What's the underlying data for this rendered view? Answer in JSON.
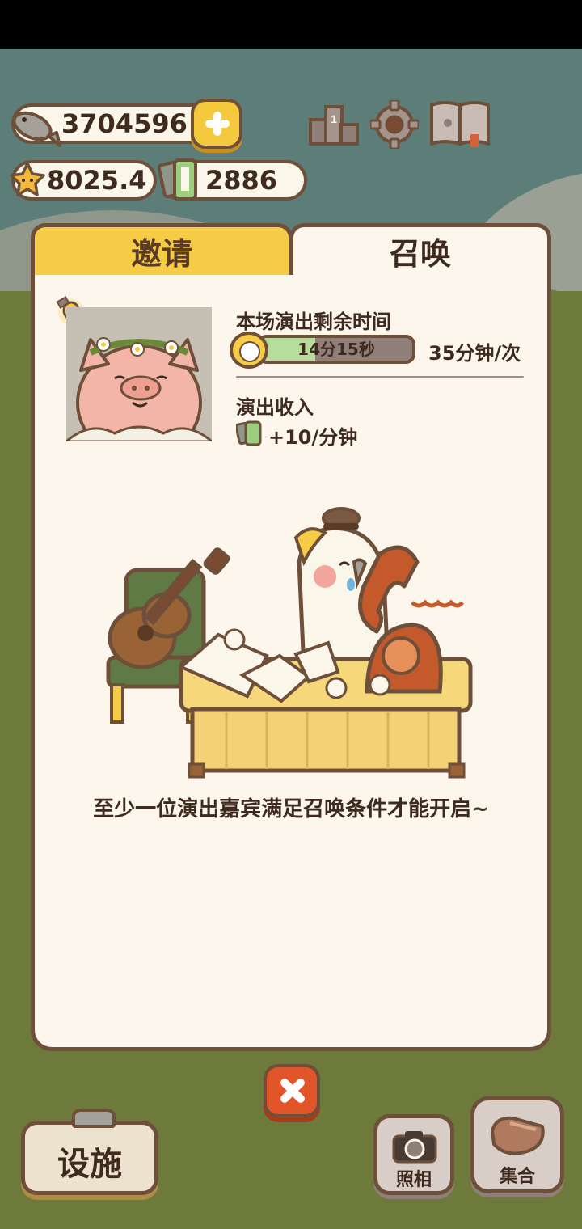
{
  "resources": {
    "fish": "3704596",
    "stars": "8025.4",
    "film": "2886"
  },
  "tabs": {
    "invite": "邀请",
    "summon": "召唤"
  },
  "performance": {
    "remaining_time_label": "本场演出剩余时间",
    "remaining_time": "14分15秒",
    "progress": 0.36,
    "rate": "35分钟/次",
    "income_label": "演出收入",
    "income": "+10/分钟"
  },
  "message": "至少一位演出嘉宾满足召唤条件才能开启~",
  "bottom": {
    "facility": "设施",
    "photo": "照相",
    "gather": "集合"
  },
  "icons": {
    "fish": "fish-icon",
    "plus": "plus-icon",
    "star": "star-icon",
    "film": "film-icon",
    "ranking": "podium-icon",
    "settings": "gear-icon",
    "album": "book-icon",
    "timer": "timer-icon",
    "close": "close-icon",
    "camera": "camera-icon",
    "whistle": "whistle-icon"
  },
  "colors": {
    "outline": "#6e4f3a",
    "tab_active": "#f6cb45",
    "panel": "#fcf6ec",
    "progress_fill": "#b7dd9d",
    "close": "#e0562a"
  }
}
